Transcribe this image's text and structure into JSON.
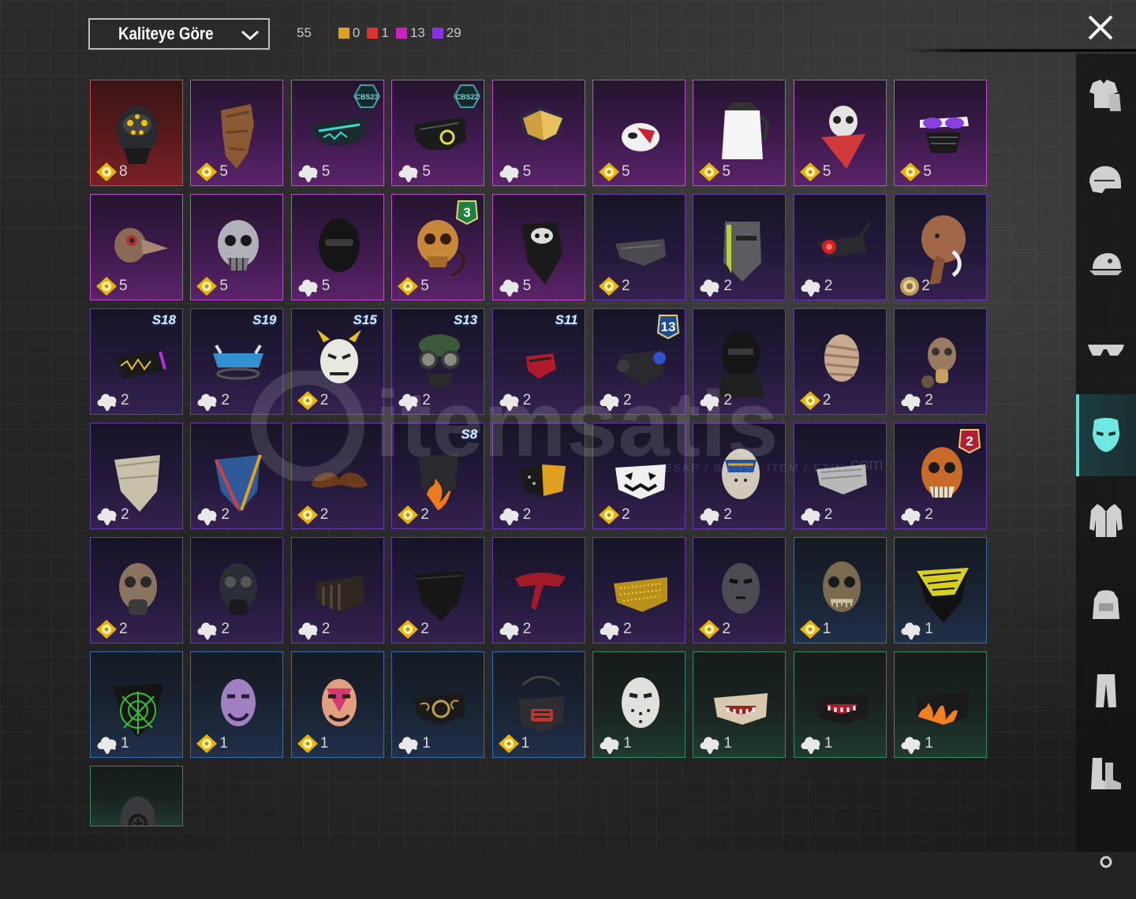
{
  "sort": {
    "label": "Kaliteye Göre"
  },
  "counts": {
    "total": "55",
    "by_quality": [
      {
        "color": "#e0a020",
        "value": "0"
      },
      {
        "color": "#e03030",
        "value": "1"
      },
      {
        "color": "#d020c0",
        "value": "13"
      },
      {
        "color": "#8a30e0",
        "value": "29"
      }
    ]
  },
  "colors": {
    "accent": "#58e0d8",
    "red": "#e03030",
    "purple": "#b030c0",
    "violet": "#5a2a9a",
    "blue": "#2e5e8e",
    "green": "#2e6e52",
    "coin": "#e8b400"
  },
  "watermark": {
    "text": "itemsatis",
    "sub": "HESAP / SATIŞ / İTEM / ETİN",
    "com": ".com"
  },
  "sidebar": [
    {
      "icon": "outfit-icon"
    },
    {
      "icon": "helmet-icon"
    },
    {
      "icon": "cap-icon"
    },
    {
      "icon": "glasses-icon"
    },
    {
      "icon": "mask-icon",
      "active": true
    },
    {
      "icon": "jacket-icon"
    },
    {
      "icon": "backpack-icon"
    },
    {
      "icon": "pants-icon"
    },
    {
      "icon": "boots-icon"
    },
    {
      "icon": "more-icon"
    }
  ],
  "items": [
    {
      "tier": "red",
      "cur": "bp",
      "qty": "8",
      "art": "spider-helmet"
    },
    {
      "tier": "purple",
      "cur": "bp",
      "qty": "5",
      "art": "scarf-tan"
    },
    {
      "tier": "purple",
      "cur": "ag",
      "qty": "5",
      "art": "cyber-mask-teal",
      "badge": "CBS23"
    },
    {
      "tier": "purple",
      "cur": "ag",
      "qty": "5",
      "art": "cyber-mask-black",
      "badge": "CBS22"
    },
    {
      "tier": "purple",
      "cur": "ag",
      "qty": "5",
      "art": "gold-visor"
    },
    {
      "tier": "purple",
      "cur": "bp",
      "qty": "5",
      "art": "white-red-mask"
    },
    {
      "tier": "purple",
      "cur": "bp",
      "qty": "5",
      "art": "white-cloth"
    },
    {
      "tier": "purple",
      "cur": "bp",
      "qty": "5",
      "art": "skull-red-scarf"
    },
    {
      "tier": "purple",
      "cur": "bp",
      "qty": "5",
      "art": "sunglasses-mask"
    },
    {
      "tier": "purple",
      "cur": "bp",
      "qty": "5",
      "art": "plague-mask"
    },
    {
      "tier": "purple",
      "cur": "bp",
      "qty": "5",
      "art": "chrome-skull"
    },
    {
      "tier": "purple",
      "cur": "ag",
      "qty": "5",
      "art": "balaclava"
    },
    {
      "tier": "purple",
      "cur": "bp",
      "qty": "5",
      "art": "gold-skull",
      "num": "3"
    },
    {
      "tier": "purple",
      "cur": "ag",
      "qty": "5",
      "art": "skull-bandana"
    },
    {
      "tier": "violet",
      "cur": "bp",
      "qty": "2",
      "art": "grey-mouth-mask"
    },
    {
      "tier": "violet",
      "cur": "ag",
      "qty": "2",
      "art": "steel-face"
    },
    {
      "tier": "violet",
      "cur": "ag",
      "qty": "2",
      "art": "red-eye-visor"
    },
    {
      "tier": "violet",
      "cur": "coin",
      "qty": "2",
      "art": "mammoth-head"
    },
    {
      "tier": "violet",
      "cur": "ag",
      "qty": "2",
      "art": "neon-mask",
      "season": "S18"
    },
    {
      "tier": "violet",
      "cur": "ag",
      "qty": "2",
      "art": "blue-visor",
      "season": "S19"
    },
    {
      "tier": "violet",
      "cur": "bp",
      "qty": "2",
      "art": "oni-mask",
      "season": "S15"
    },
    {
      "tier": "violet",
      "cur": "ag",
      "qty": "2",
      "art": "goggles-cap",
      "season": "S13"
    },
    {
      "tier": "violet",
      "cur": "ag",
      "qty": "2",
      "art": "red-small-mask",
      "season": "S11"
    },
    {
      "tier": "violet",
      "cur": "ag",
      "qty": "2",
      "art": "blue-respirator",
      "num": "13"
    },
    {
      "tier": "violet",
      "cur": "ag",
      "qty": "2",
      "art": "black-hood"
    },
    {
      "tier": "violet",
      "cur": "bp",
      "qty": "2",
      "art": "mummy-head"
    },
    {
      "tier": "violet",
      "cur": "ag",
      "qty": "2",
      "art": "gas-mask-tan"
    },
    {
      "tier": "violet",
      "cur": "ag",
      "qty": "2",
      "art": "bandana-cream"
    },
    {
      "tier": "violet",
      "cur": "ag",
      "qty": "2",
      "art": "bandana-blue"
    },
    {
      "tier": "violet",
      "cur": "bp",
      "qty": "2",
      "art": "moustache"
    },
    {
      "tier": "violet",
      "cur": "bp",
      "qty": "2",
      "art": "flame-bandana",
      "season": "S8"
    },
    {
      "tier": "violet",
      "cur": "ag",
      "qty": "2",
      "art": "black-yellow-mask"
    },
    {
      "tier": "violet",
      "cur": "bp",
      "qty": "2",
      "art": "jack-o-mask"
    },
    {
      "tier": "violet",
      "cur": "ag",
      "qty": "2",
      "art": "painted-hockey"
    },
    {
      "tier": "violet",
      "cur": "ag",
      "qty": "2",
      "art": "grey-cloth-mask"
    },
    {
      "tier": "violet",
      "cur": "ag",
      "qty": "2",
      "art": "orange-skull-mask",
      "num": "2"
    },
    {
      "tier": "violet",
      "cur": "bp",
      "qty": "2",
      "art": "rust-gas-mask"
    },
    {
      "tier": "violet",
      "cur": "ag",
      "qty": "2",
      "art": "dark-gas-mask"
    },
    {
      "tier": "violet",
      "cur": "ag",
      "qty": "2",
      "art": "leather-muzzle"
    },
    {
      "tier": "violet",
      "cur": "bp",
      "qty": "2",
      "art": "black-bandana"
    },
    {
      "tier": "violet",
      "cur": "ag",
      "qty": "2",
      "art": "red-tie-bandana"
    },
    {
      "tier": "violet",
      "cur": "ag",
      "qty": "2",
      "art": "gold-cloth-mask"
    },
    {
      "tier": "violet",
      "cur": "bp",
      "qty": "2",
      "art": "steel-hockey"
    },
    {
      "tier": "blue",
      "cur": "bp",
      "qty": "1",
      "art": "zombie-mask"
    },
    {
      "tier": "blue",
      "cur": "ag",
      "qty": "1",
      "art": "yellow-net-bandana"
    },
    {
      "tier": "blue",
      "cur": "ag",
      "qty": "1",
      "art": "web-bandana"
    },
    {
      "tier": "blue",
      "cur": "bp",
      "qty": "1",
      "art": "purple-theater-mask"
    },
    {
      "tier": "blue",
      "cur": "bp",
      "qty": "1",
      "art": "pink-theater-mask"
    },
    {
      "tier": "blue",
      "cur": "ag",
      "qty": "1",
      "art": "gold-pattern-mask"
    },
    {
      "tier": "blue",
      "cur": "bp",
      "qty": "1",
      "art": "half-respirator"
    },
    {
      "tier": "green",
      "cur": "ag",
      "qty": "1",
      "art": "white-hockey"
    },
    {
      "tier": "green",
      "cur": "ag",
      "qty": "1",
      "art": "teeth-mask"
    },
    {
      "tier": "green",
      "cur": "ag",
      "qty": "1",
      "art": "red-teeth-mask"
    },
    {
      "tier": "green",
      "cur": "ag",
      "qty": "1",
      "art": "flame-mask"
    },
    {
      "tier": "green",
      "cur": "none",
      "qty": "",
      "art": "gas-mask-grey"
    }
  ]
}
